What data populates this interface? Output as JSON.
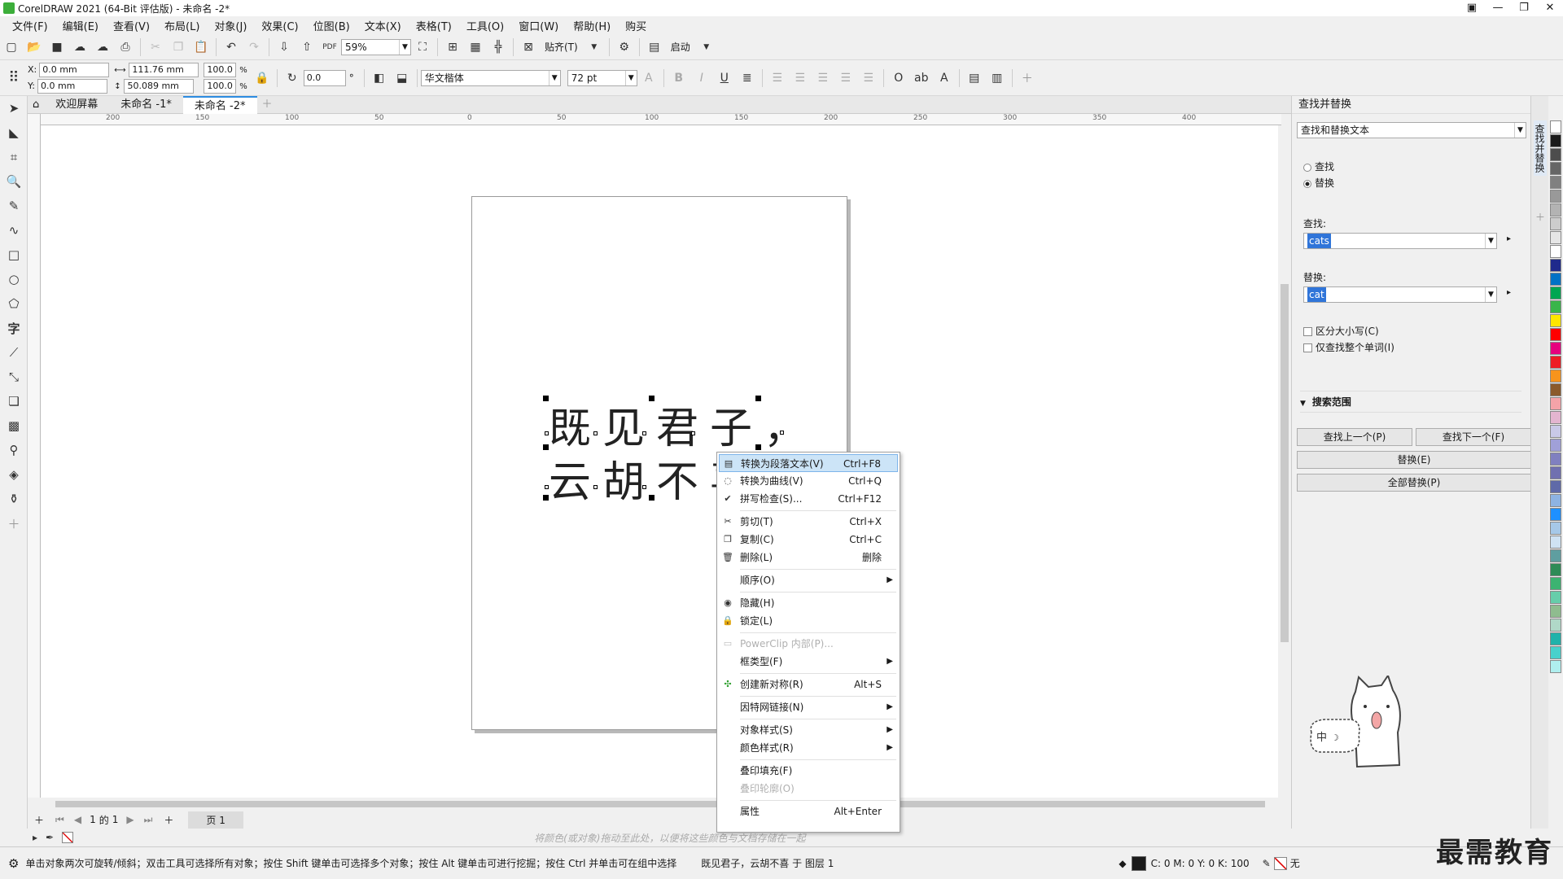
{
  "window": {
    "title": "CorelDRAW 2021 (64-Bit 评估版) - 未命名 -2*",
    "controls": [
      "▣",
      "—",
      "❐",
      "✕"
    ]
  },
  "menu": [
    "文件(F)",
    "编辑(E)",
    "查看(V)",
    "布局(L)",
    "对象(J)",
    "效果(C)",
    "位图(B)",
    "文本(X)",
    "表格(T)",
    "工具(O)",
    "窗口(W)",
    "帮助(H)",
    "购买"
  ],
  "standard_toolbar": {
    "zoom": "59%",
    "snap_label": "贴齐(T)",
    "launch_label": "启动"
  },
  "property_bar": {
    "x_label": "X:",
    "x": "0.0 mm",
    "y_label": "Y:",
    "y": "0.0 mm",
    "width": "111.76 mm",
    "height": "50.089 mm",
    "scale_w": "100.0",
    "scale_h": "100.0",
    "pct": "%",
    "rotation": "0.0",
    "degree": "°",
    "font": "华文楷体",
    "font_size": "72 pt"
  },
  "doc_tabs": [
    "欢迎屏幕",
    "未命名 -1*",
    "未命名 -2*"
  ],
  "ruler_labels": [
    "200",
    "150",
    "100",
    "50",
    "0",
    "50",
    "100",
    "150",
    "200",
    "250",
    "300",
    "350",
    "400"
  ],
  "canvas_text": {
    "line1": "既见君子，",
    "line2": "云胡不喜"
  },
  "context_menu": [
    {
      "icon": "convert-paragraph-icon",
      "label": "转换为段落文本(V)",
      "shortcut": "Ctrl+F8",
      "highlighted": true
    },
    {
      "icon": "convert-curves-icon",
      "label": "转换为曲线(V)",
      "shortcut": "Ctrl+Q"
    },
    {
      "icon": "spellcheck-icon",
      "label": "拼写检查(S)...",
      "shortcut": "Ctrl+F12"
    },
    {
      "sep": true
    },
    {
      "icon": "cut-icon",
      "label": "剪切(T)",
      "shortcut": "Ctrl+X"
    },
    {
      "icon": "copy-icon",
      "label": "复制(C)",
      "shortcut": "Ctrl+C"
    },
    {
      "icon": "delete-icon",
      "label": "删除(L)",
      "shortcut": "删除"
    },
    {
      "sep": true
    },
    {
      "label": "顺序(O)",
      "submenu": true
    },
    {
      "sep": true
    },
    {
      "icon": "hide-icon",
      "label": "隐藏(H)"
    },
    {
      "icon": "lock-icon",
      "label": "锁定(L)"
    },
    {
      "sep": true
    },
    {
      "icon": "powerclip-icon",
      "label": "PowerClip 内部(P)...",
      "disabled": true
    },
    {
      "label": "框类型(F)",
      "submenu": true
    },
    {
      "sep": true
    },
    {
      "icon": "symbol-icon",
      "label": "创建新对称(R)",
      "shortcut": "Alt+S"
    },
    {
      "sep": true
    },
    {
      "label": "因特网链接(N)",
      "submenu": true
    },
    {
      "sep": true
    },
    {
      "label": "对象样式(S)",
      "submenu": true
    },
    {
      "label": "颜色样式(R)",
      "submenu": true
    },
    {
      "sep": true
    },
    {
      "label": "叠印填充(F)"
    },
    {
      "label": "叠印轮廓(O)",
      "disabled": true
    },
    {
      "sep": true
    },
    {
      "label": "属性",
      "shortcut": "Alt+Enter"
    }
  ],
  "page_nav": {
    "current": "1",
    "of": "的",
    "total": "1",
    "page_tab": "页 1"
  },
  "color_hint": "将颜色(或对象)拖动至此处，以便将这些颜色与文档存储在一起",
  "docker": {
    "title": "查找并替换",
    "mode": "查找和替换文本",
    "radio_find": "查找",
    "radio_replace": "替换",
    "find_label": "查找:",
    "find_value": "cats",
    "replace_label": "替换:",
    "replace_value": "cat",
    "match_case": "区分大小写(C)",
    "whole_word": "仅查找整个单词(I)",
    "scope": "搜索范围",
    "btn_prev": "查找上一个(P)",
    "btn_next": "查找下一个(F)",
    "btn_replace": "替换(E)",
    "btn_replace_all": "全部替换(P)",
    "side_tab": "查找并替换"
  },
  "status": {
    "hint": "单击对象两次可旋转/倾斜；双击工具可选择所有对象；按住 Shift 键单击可选择多个对象；按住 Alt 键单击可进行挖掘；按住 Ctrl 并单击可在组中选择",
    "selection": "既见君子，云胡不喜 于 图层 1",
    "cmyk": "C: 0 M: 0 Y: 0 K: 100",
    "outline": "无"
  },
  "watermark": "最需教育",
  "palette": [
    "#ffffff",
    "#1a1a1a",
    "#4d4d4d",
    "#666666",
    "#808080",
    "#999999",
    "#b3b3b3",
    "#cccccc",
    "#e6e6e6",
    "#ffffff",
    "#1f2a8c",
    "#0072c6",
    "#00a651",
    "#39b54a",
    "#ffe600",
    "#ff0000",
    "#e6007e",
    "#ed1c24",
    "#f7941d",
    "#8b5a2b",
    "#f4a3a8",
    "#e3b5d0",
    "#c9c9e8",
    "#a0a0d8",
    "#8080c0",
    "#7070b0",
    "#5f6aa8",
    "#8db3e2",
    "#1e90ff",
    "#a6c8e8",
    "#cfe2f3",
    "#5f9ea0",
    "#2e8b57",
    "#3cb371",
    "#66cdaa",
    "#8fbc8f",
    "#b0d8c8",
    "#20b2aa",
    "#48d1cc",
    "#afeeee"
  ]
}
